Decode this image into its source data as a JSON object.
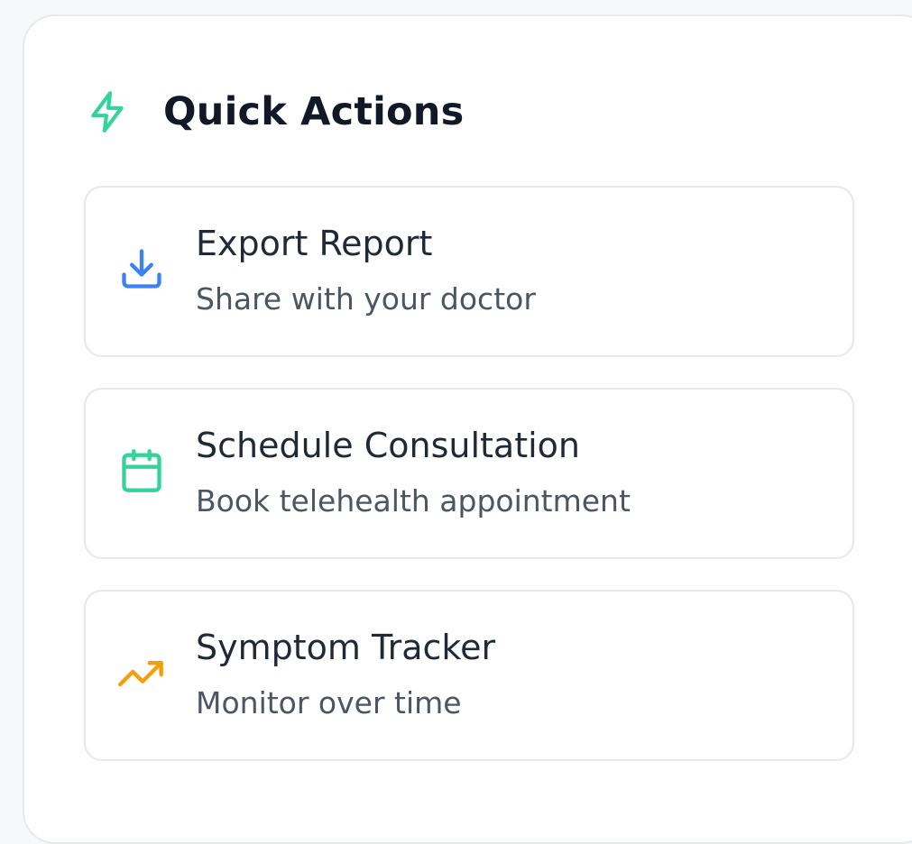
{
  "panel": {
    "title": "Quick Actions",
    "icon": "lightning-bolt-icon",
    "icon_color": "#34d399"
  },
  "actions": [
    {
      "title": "Export Report",
      "description": "Share with your doctor",
      "icon": "download-icon",
      "icon_color": "#3b82f6"
    },
    {
      "title": "Schedule Consultation",
      "description": "Book telehealth appointment",
      "icon": "calendar-icon",
      "icon_color": "#34d399"
    },
    {
      "title": "Symptom Tracker",
      "description": "Monitor over time",
      "icon": "trending-up-icon",
      "icon_color": "#f59e0b"
    }
  ]
}
